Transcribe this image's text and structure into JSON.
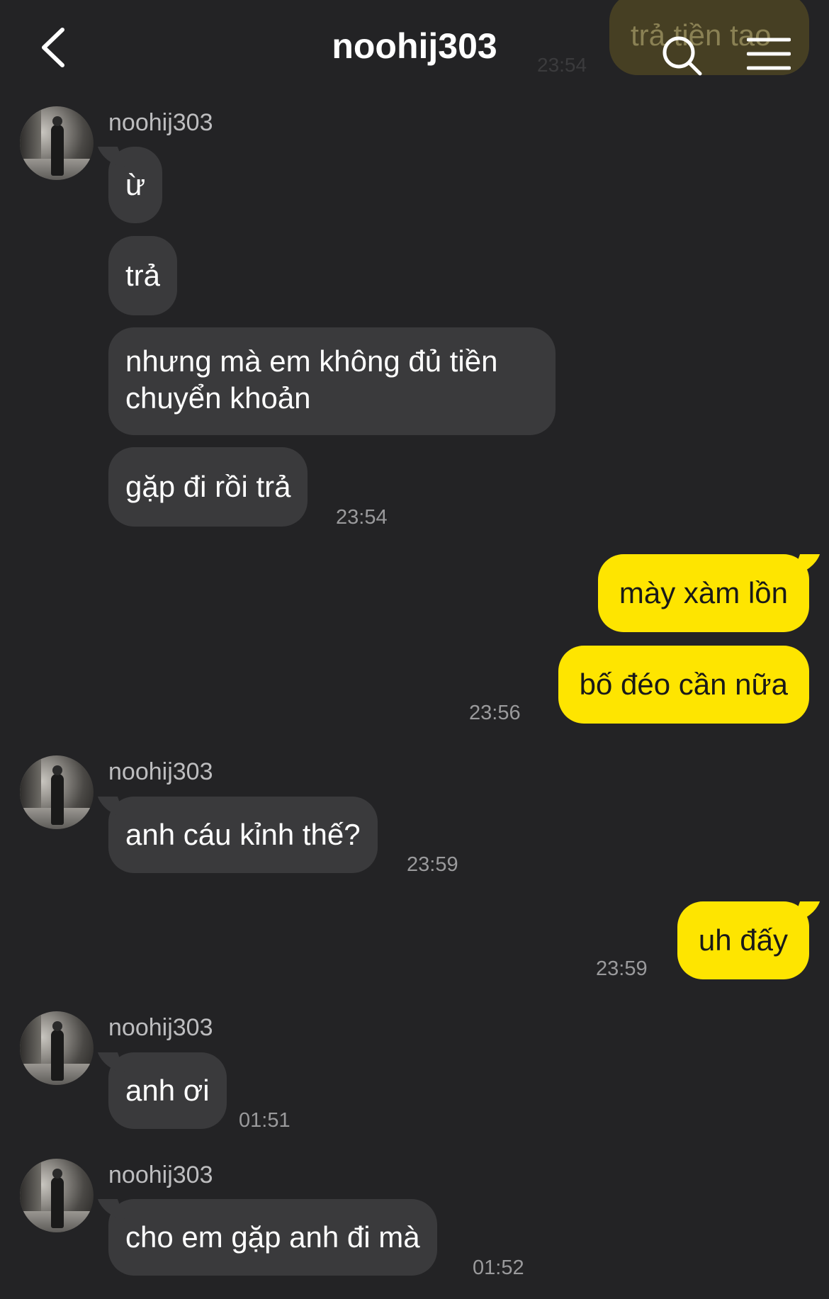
{
  "header": {
    "title": "noohij303",
    "back_icon": "chevron-left-icon",
    "search_icon": "search-icon",
    "menu_icon": "hamburger-menu-icon"
  },
  "ghost": {
    "text": "trả tiền tao",
    "time": "23:54"
  },
  "colors": {
    "background": "#232325",
    "incoming_bubble": "#3a3a3c",
    "outgoing_bubble": "#fee500",
    "timestamp": "#9a9a9c"
  },
  "messages": {
    "g1": {
      "sender": "noohij303",
      "m1": "ừ",
      "m2": "trả",
      "m3_line1": "nhưng mà em không đủ tiền",
      "m3_line2": "chuyển khoản",
      "m4": "gặp đi rồi trả",
      "time": "23:54"
    },
    "o1": {
      "m1": "mày xàm lồn",
      "m2": "bố đéo cần nữa",
      "time": "23:56"
    },
    "g2": {
      "sender": "noohij303",
      "m1": "anh cáu kỉnh thế?",
      "time": "23:59"
    },
    "o2": {
      "m1": "uh đấy",
      "time": "23:59"
    },
    "g3": {
      "sender": "noohij303",
      "m1": "anh ơi",
      "time": "01:51"
    },
    "g4": {
      "sender": "noohij303",
      "m1": "cho em gặp anh đi mà",
      "time": "01:52"
    }
  }
}
